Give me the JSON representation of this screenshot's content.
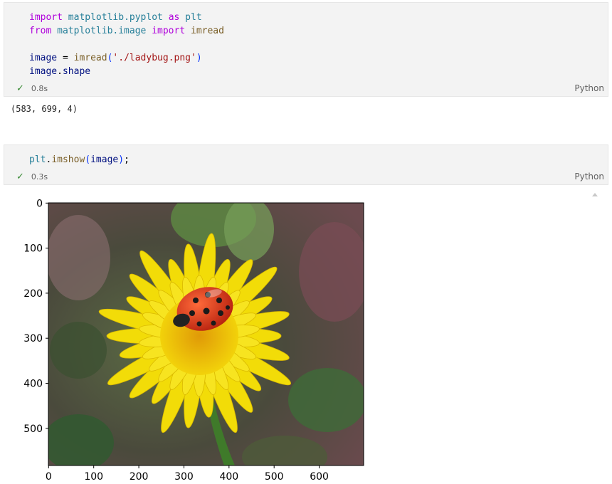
{
  "cells": [
    {
      "code_lines": [
        [
          [
            "kw",
            "import"
          ],
          [
            "txt",
            " "
          ],
          [
            "mod",
            "matplotlib.pyplot"
          ],
          [
            "txt",
            " "
          ],
          [
            "kw",
            "as"
          ],
          [
            "txt",
            " "
          ],
          [
            "mod",
            "plt"
          ]
        ],
        [
          [
            "kw",
            "from"
          ],
          [
            "txt",
            " "
          ],
          [
            "mod",
            "matplotlib.image"
          ],
          [
            "txt",
            " "
          ],
          [
            "kw",
            "import"
          ],
          [
            "txt",
            " "
          ],
          [
            "fn",
            "imread"
          ]
        ],
        [],
        [
          [
            "var",
            "image"
          ],
          [
            "txt",
            " = "
          ],
          [
            "fn",
            "imread"
          ],
          [
            "pun",
            "("
          ],
          [
            "str",
            "'./ladybug.png'"
          ],
          [
            "pun",
            ")"
          ]
        ],
        [
          [
            "var",
            "image"
          ],
          [
            "txt",
            "."
          ],
          [
            "var",
            "shape"
          ]
        ]
      ],
      "status": "0.8s",
      "language": "Python",
      "output": "(583, 699, 4)"
    },
    {
      "code_lines": [
        [
          [
            "mod",
            "plt"
          ],
          [
            "txt",
            "."
          ],
          [
            "fn",
            "imshow"
          ],
          [
            "pun",
            "("
          ],
          [
            "var",
            "image"
          ],
          [
            "pun",
            ")"
          ],
          [
            "txt",
            ";"
          ]
        ]
      ],
      "status": "0.3s",
      "language": "Python"
    }
  ],
  "plot": {
    "y_ticks": [
      "0",
      "100",
      "200",
      "300",
      "400",
      "500"
    ],
    "x_ticks": [
      "0",
      "100",
      "200",
      "300",
      "400",
      "500",
      "600"
    ]
  },
  "colors": {
    "cell_bg": "#f3f3f3",
    "check": "#388a34",
    "petal": "#f2dc08",
    "ladybug": "#d8341c"
  }
}
